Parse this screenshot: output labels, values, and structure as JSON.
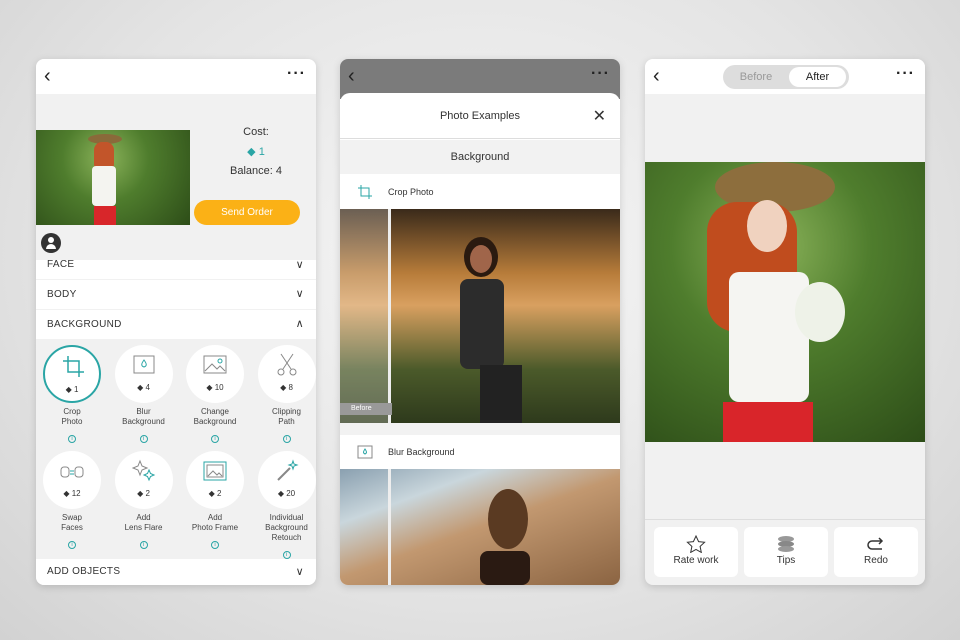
{
  "panel1": {
    "cost_label": "Cost:",
    "cost_value": "1",
    "balance": "Balance: 4",
    "send_order": "Send Order",
    "sections": {
      "face": "FACE",
      "body": "BODY",
      "background": "BACKGROUND",
      "add_objects": "ADD OBJECTS"
    },
    "services": [
      {
        "name": "Crop Photo",
        "l1": "Crop",
        "l2": "Photo",
        "l3": "",
        "price": "1",
        "icon": "crop-icon"
      },
      {
        "name": "Blur Background",
        "l1": "Blur",
        "l2": "Background",
        "l3": "",
        "price": "4",
        "icon": "blur-icon"
      },
      {
        "name": "Change Background",
        "l1": "Change",
        "l2": "Background",
        "l3": "",
        "price": "10",
        "icon": "image-icon"
      },
      {
        "name": "Clipping Path",
        "l1": "Clipping",
        "l2": "Path",
        "l3": "",
        "price": "8",
        "icon": "scissors-icon"
      },
      {
        "name": "Swap Faces",
        "l1": "Swap",
        "l2": "Faces",
        "l3": "",
        "price": "12",
        "icon": "swap-faces-icon"
      },
      {
        "name": "Add Lens Flare",
        "l1": "Add",
        "l2": "Lens Flare",
        "l3": "",
        "price": "2",
        "icon": "sparkle-icon"
      },
      {
        "name": "Add Photo Frame",
        "l1": "Add",
        "l2": "Photo Frame",
        "l3": "",
        "price": "2",
        "icon": "frame-icon"
      },
      {
        "name": "Individual Background Retouch",
        "l1": "Individual",
        "l2": "Background",
        "l3": "Retouch",
        "price": "20",
        "icon": "magic-wand-icon"
      }
    ]
  },
  "panel2": {
    "title": "Photo Examples",
    "section": "Background",
    "items": [
      "Crop Photo",
      "Blur Background"
    ],
    "before_label": "Before"
  },
  "panel3": {
    "tabs": [
      "Before",
      "After"
    ],
    "active_tab": "After",
    "actions": [
      "Rate work",
      "Tips",
      "Redo"
    ]
  },
  "colors": {
    "accent": "#2aa5a5",
    "order": "#fbb116"
  }
}
